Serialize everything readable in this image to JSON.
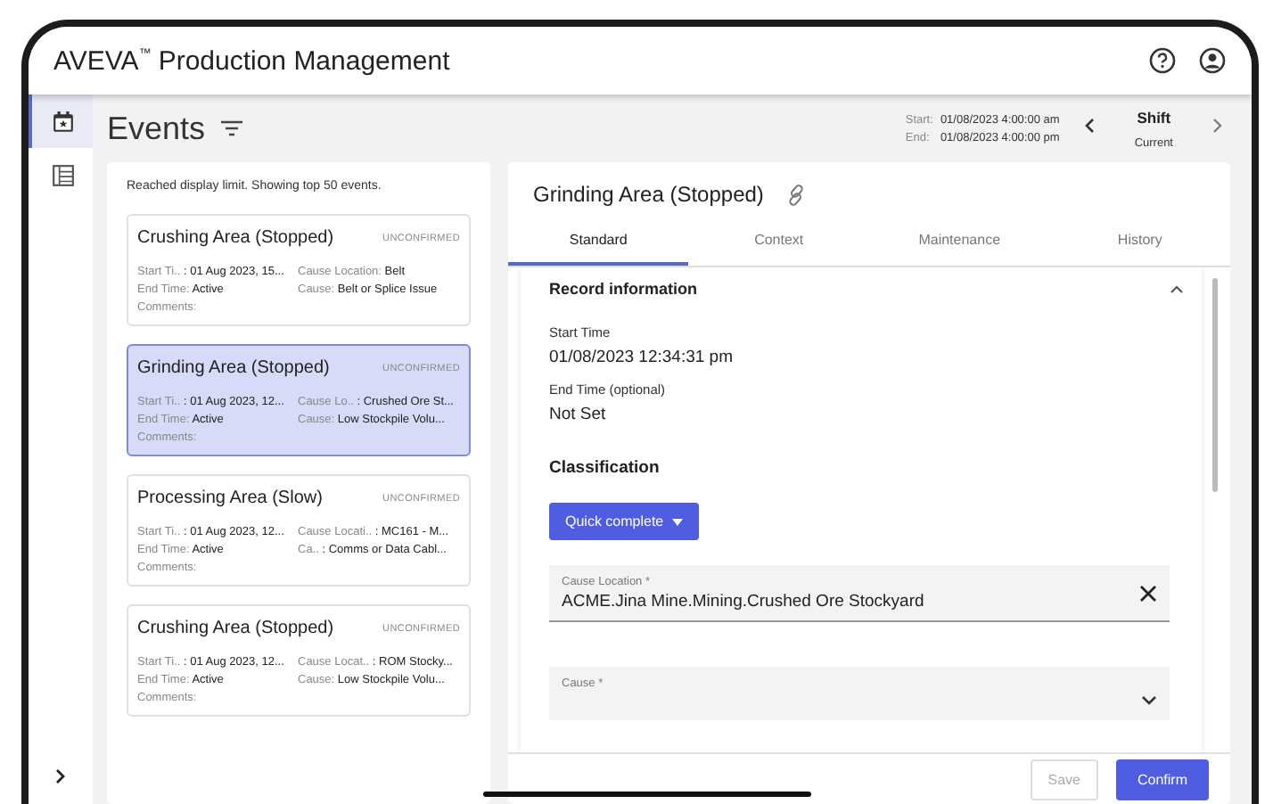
{
  "app": {
    "title": "AVEVA",
    "trademark": "™",
    "subtitle": "Production Management"
  },
  "nav": [
    {
      "selected": true,
      "kind": "calendar"
    },
    {
      "selected": false,
      "kind": "list"
    }
  ],
  "events": {
    "title": "Events",
    "notice": "Reached display limit. Showing top 50 events.",
    "items": [
      {
        "title": "Crushing Area (Stopped)",
        "status": "UNCONFIRMED",
        "selected": false,
        "start_label": "Start Ti..",
        "start": ": 01 Aug 2023, 15...",
        "loc_label": "Cause Location:",
        "loc": "Belt",
        "end_label": "End Time:",
        "end": "Active",
        "cause_label": "Cause:",
        "cause": "Belt or Splice Issue",
        "comments": "Comments:"
      },
      {
        "title": "Grinding Area (Stopped)",
        "status": "UNCONFIRMED",
        "selected": true,
        "start_label": "Start Ti..",
        "start": ": 01 Aug 2023, 12...",
        "loc_label": "Cause Lo..",
        "loc": ": Crushed Ore St...",
        "end_label": "End Time:",
        "end": "Active",
        "cause_label": "Cause:",
        "cause": "Low Stockpile Volu...",
        "comments": "Comments:"
      },
      {
        "title": "Processing Area (Slow)",
        "status": "UNCONFIRMED",
        "selected": false,
        "start_label": "Start Ti..",
        "start": ": 01 Aug 2023, 12...",
        "loc_label": "Cause Locati..",
        "loc": ": MC161 - M...",
        "end_label": "End Time:",
        "end": "Active",
        "cause_label": "Ca..",
        "cause": ": Comms or Data Cabl...",
        "comments": "Comments:"
      },
      {
        "title": "Crushing Area (Stopped)",
        "status": "UNCONFIRMED",
        "selected": false,
        "start_label": "Start Ti..",
        "start": ": 01 Aug 2023, 12...",
        "loc_label": "Cause Locat..",
        "loc": ": ROM Stocky...",
        "end_label": "End Time:",
        "end": "Active",
        "cause_label": "Cause:",
        "cause": "Low Stockpile Volu...",
        "comments": "Comments:"
      }
    ]
  },
  "range": {
    "start_label": "Start:",
    "start": "01/08/2023 4:00:00 am",
    "end_label": "End:",
    "end": "01/08/2023 4:00:00 pm",
    "period": "Shift",
    "period_sub": "Current"
  },
  "detail": {
    "title": "Grinding Area (Stopped)",
    "tabs": [
      {
        "label": "Standard",
        "selected": true
      },
      {
        "label": "Context",
        "selected": false
      },
      {
        "label": "Maintenance",
        "selected": false
      },
      {
        "label": "History",
        "selected": false
      }
    ],
    "section": "Record information",
    "expanded": true,
    "fields": [
      {
        "label": "Start Time",
        "value": "01/08/2023 12:34:31 pm"
      },
      {
        "label": "End Time (optional)",
        "value": "Not Set"
      }
    ],
    "classification": "Classification",
    "quick": "Quick complete",
    "cause_location": {
      "label": "Cause Location *",
      "value": "ACME.Jina Mine.Mining.Crushed Ore Stockyard"
    },
    "cause": {
      "label": "Cause *"
    },
    "buttons": [
      {
        "label": "Save",
        "disabled": true
      },
      {
        "label": "Confirm",
        "disabled": false
      }
    ]
  }
}
